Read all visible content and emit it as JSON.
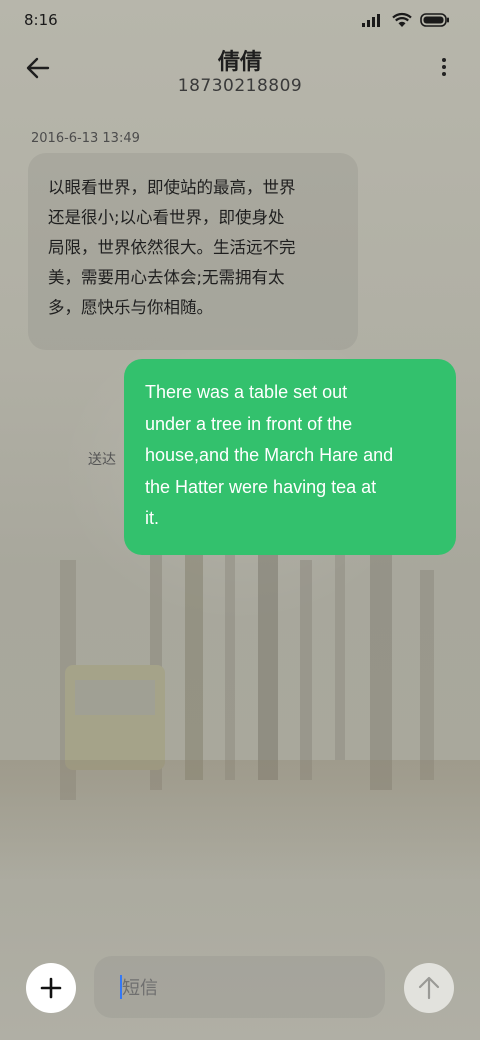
{
  "status_bar": {
    "time": "8:16",
    "icons": [
      "signal-icon",
      "wifi-icon",
      "battery-icon"
    ]
  },
  "header": {
    "contact_name": "倩倩",
    "phone_number": "18730218809",
    "icons": [
      "back-arrow-icon",
      "more-vertical-icon"
    ]
  },
  "conversation": {
    "timestamp": "2016-6-13 13:49",
    "incoming": {
      "lines": [
        "以眼看世界，即使站的最高，世界",
        "还是很小;以心看世界，即使身处",
        "局限，世界依然很大。生活远不完",
        "美，需要用心去体会;无需拥有太",
        "多，愿快乐与你相随。"
      ]
    },
    "outgoing": {
      "lines": [
        "There was a table set out",
        "under a tree in front of the",
        "house,and the March Hare and",
        "the Hatter were having tea at",
        "it."
      ],
      "status": "送达",
      "color": "#33c16d"
    }
  },
  "composer": {
    "placeholder": "短信",
    "icons": [
      "plus-icon",
      "send-arrow-icon"
    ]
  }
}
